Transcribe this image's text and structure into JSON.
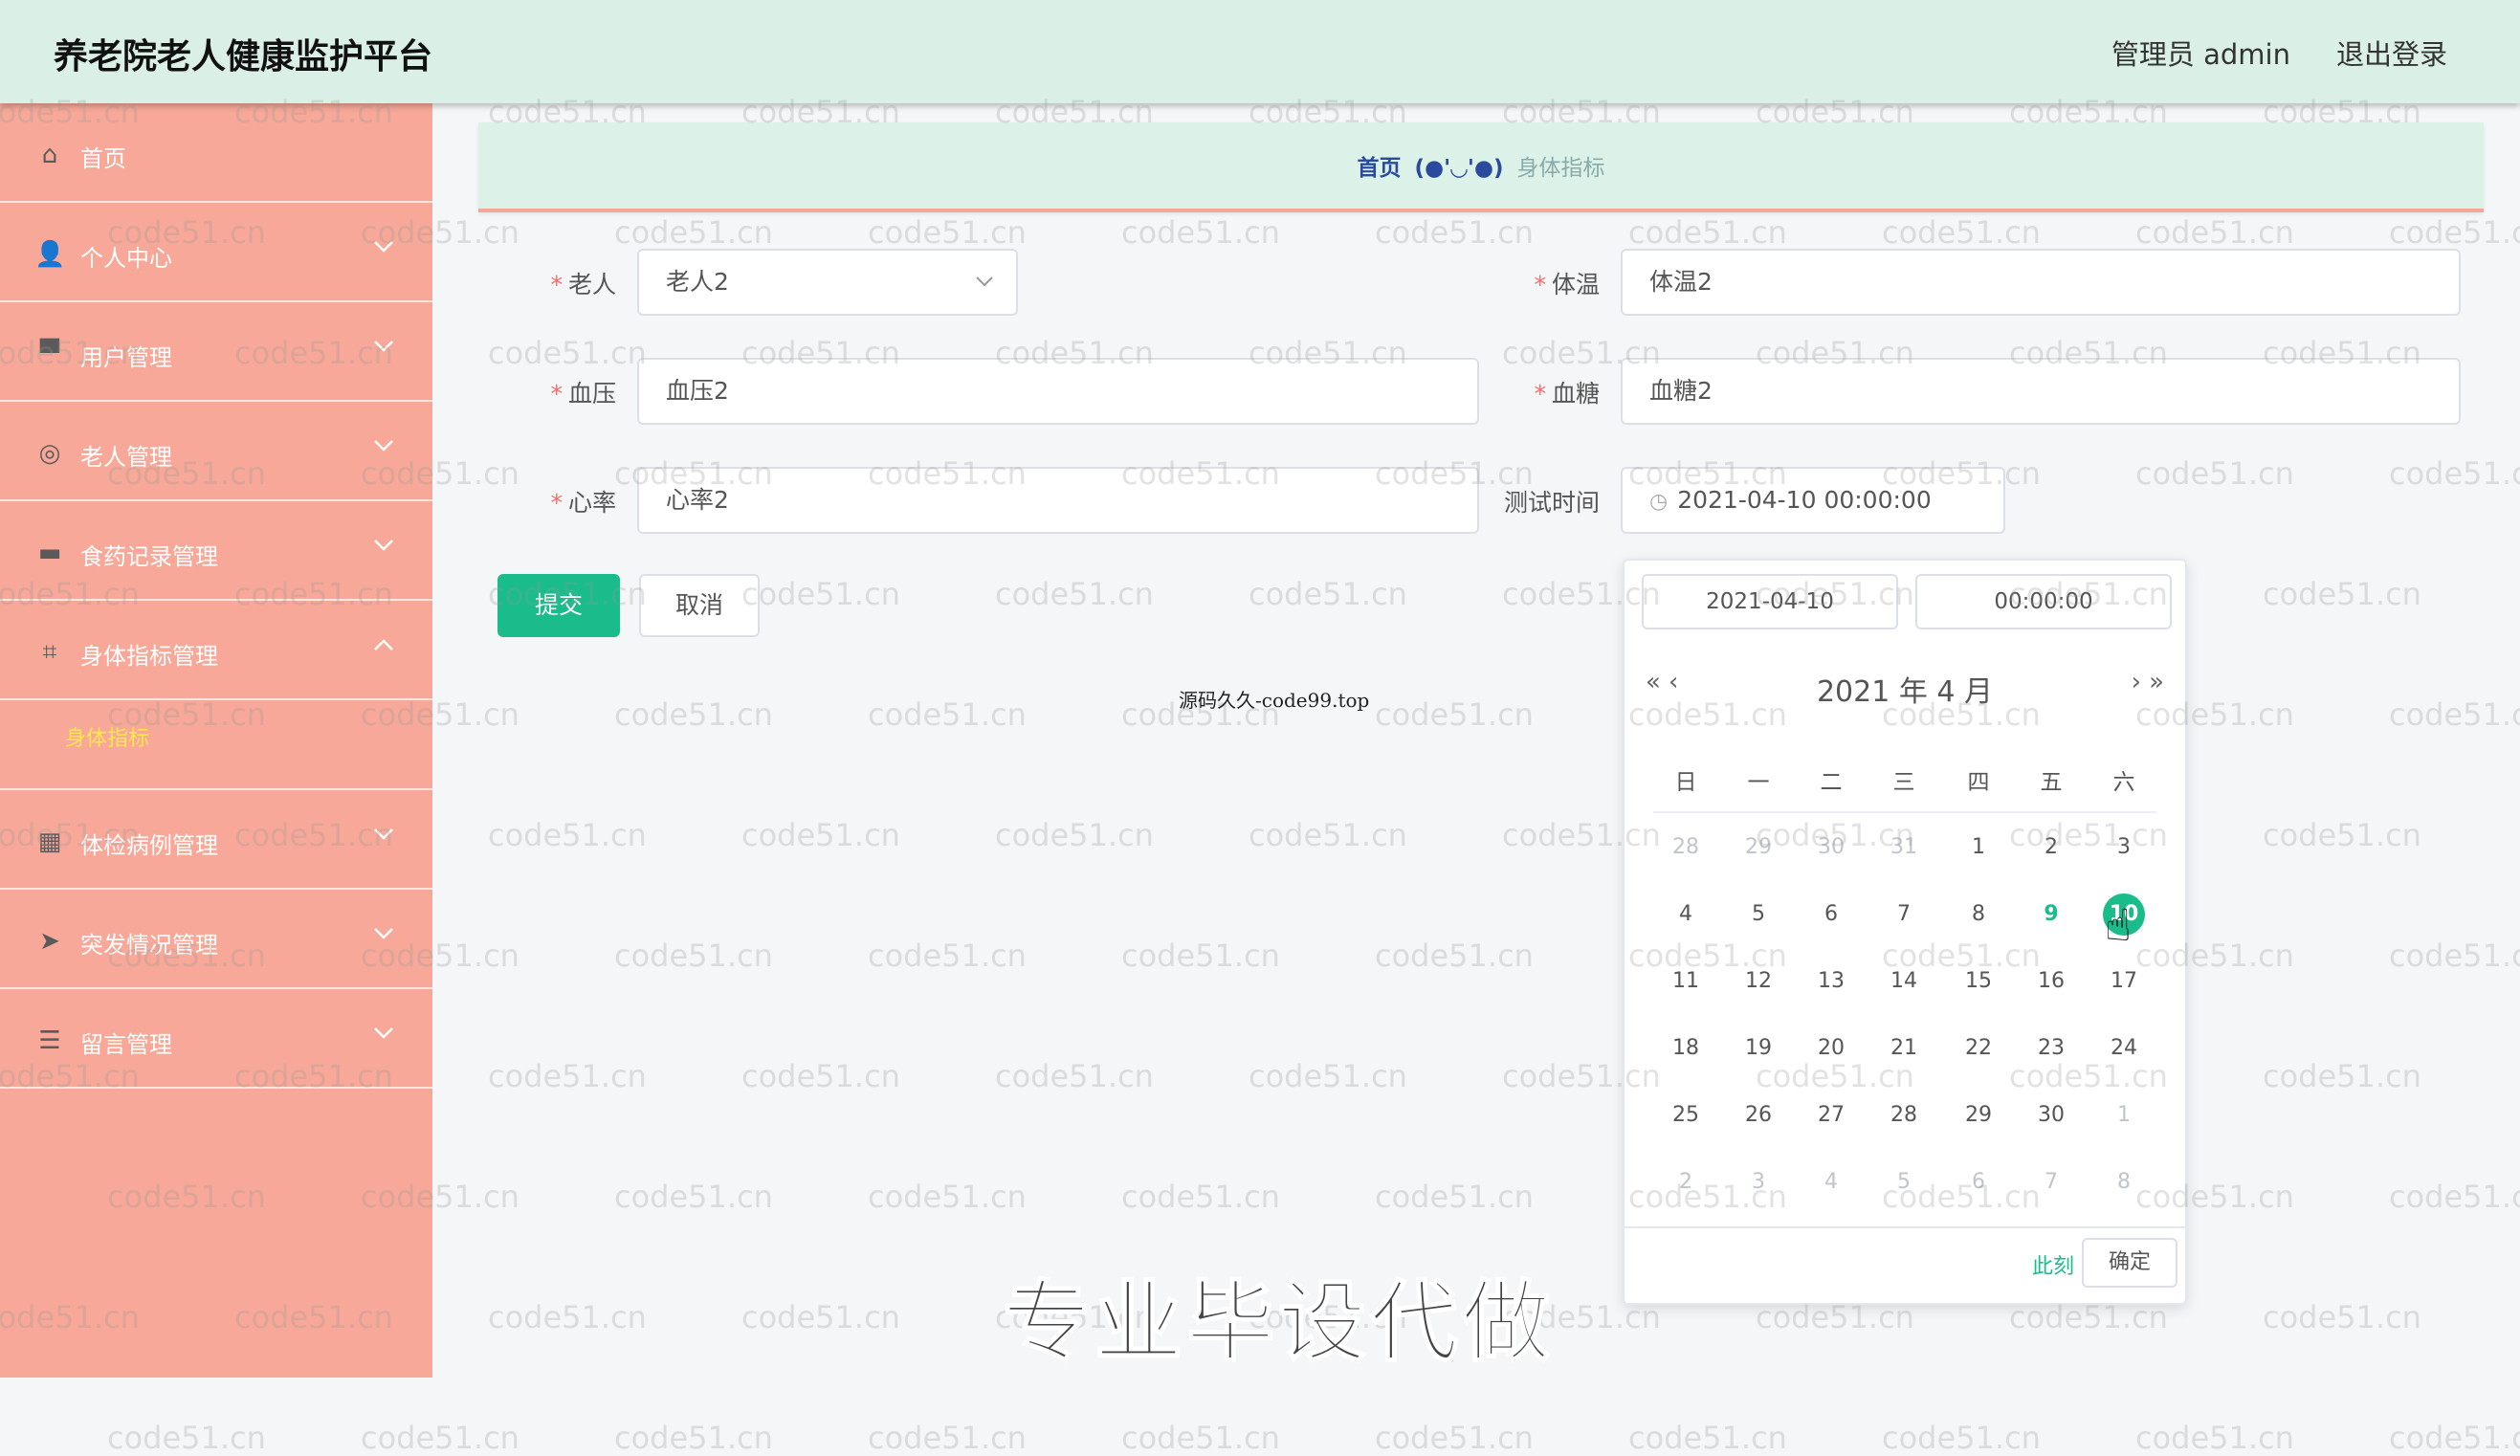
{
  "header": {
    "app_title": "养老院老人健康监护平台",
    "admin_label": "管理员 admin",
    "logout_label": "退出登录"
  },
  "sidebar": {
    "items": [
      {
        "label": "首页",
        "icon": "home-icon",
        "arrow": false
      },
      {
        "label": "个人中心",
        "icon": "user-icon",
        "arrow": true
      },
      {
        "label": "用户管理",
        "icon": "display-icon",
        "arrow": true
      },
      {
        "label": "老人管理",
        "icon": "compass-icon",
        "arrow": true
      },
      {
        "label": "食药记录管理",
        "icon": "monitor-icon",
        "arrow": true
      },
      {
        "label": "身体指标管理",
        "icon": "crop-icon",
        "arrow": true,
        "expanded": true,
        "subitems": [
          "身体指标"
        ]
      },
      {
        "label": "体检病例管理",
        "icon": "grid-icon",
        "arrow": true
      },
      {
        "label": "突发情况管理",
        "icon": "navigation-icon",
        "arrow": true
      },
      {
        "label": "留言管理",
        "icon": "list-icon",
        "arrow": true
      }
    ]
  },
  "breadcrumb": {
    "home": "首页",
    "separator": "(●'◡'●)",
    "current": "身体指标"
  },
  "form": {
    "elder": {
      "label": "老人",
      "value": "老人2",
      "required": true
    },
    "temperature": {
      "label": "体温",
      "value": "体温2",
      "required": true
    },
    "blood_pressure": {
      "label": "血压",
      "value": "血压2",
      "required": true
    },
    "blood_sugar": {
      "label": "血糖",
      "value": "血糖2",
      "required": true
    },
    "heart_rate": {
      "label": "心率",
      "value": "心率2",
      "required": true
    },
    "test_time": {
      "label": "测试时间",
      "value": "2021-04-10 00:00:00"
    },
    "submit_label": "提交",
    "cancel_label": "取消"
  },
  "datepicker": {
    "date_input": "2021-04-10",
    "time_input": "00:00:00",
    "prev_year": "«",
    "prev_month": "‹",
    "next_month": "›",
    "next_year": "»",
    "title": "2021 年  4 月",
    "weekdays": [
      "日",
      "一",
      "二",
      "三",
      "四",
      "五",
      "六"
    ],
    "weeks": [
      [
        {
          "d": "28",
          "o": true
        },
        {
          "d": "29",
          "o": true
        },
        {
          "d": "30",
          "o": true
        },
        {
          "d": "31",
          "o": true
        },
        {
          "d": "1"
        },
        {
          "d": "2"
        },
        {
          "d": "3"
        }
      ],
      [
        {
          "d": "4"
        },
        {
          "d": "5"
        },
        {
          "d": "6"
        },
        {
          "d": "7"
        },
        {
          "d": "8"
        },
        {
          "d": "9",
          "today": true
        },
        {
          "d": "10",
          "sel": true
        }
      ],
      [
        {
          "d": "11"
        },
        {
          "d": "12"
        },
        {
          "d": "13"
        },
        {
          "d": "14"
        },
        {
          "d": "15"
        },
        {
          "d": "16"
        },
        {
          "d": "17"
        }
      ],
      [
        {
          "d": "18"
        },
        {
          "d": "19"
        },
        {
          "d": "20"
        },
        {
          "d": "21"
        },
        {
          "d": "22"
        },
        {
          "d": "23"
        },
        {
          "d": "24"
        }
      ],
      [
        {
          "d": "25"
        },
        {
          "d": "26"
        },
        {
          "d": "27"
        },
        {
          "d": "28"
        },
        {
          "d": "29"
        },
        {
          "d": "30"
        },
        {
          "d": "1",
          "o": true
        }
      ],
      [
        {
          "d": "2",
          "o": true
        },
        {
          "d": "3",
          "o": true
        },
        {
          "d": "4",
          "o": true
        },
        {
          "d": "5",
          "o": true
        },
        {
          "d": "6",
          "o": true
        },
        {
          "d": "7",
          "o": true
        },
        {
          "d": "8",
          "o": true
        }
      ]
    ],
    "now_label": "此刻",
    "ok_label": "确定"
  },
  "overlay": {
    "small_text": "源码久久-code99.top",
    "big_text": "专业毕设代做",
    "watermark": "code51.cn"
  },
  "colors": {
    "topbar": "#daf0e6",
    "sidebar": "#f7a898",
    "primary": "#1abc8c",
    "active_submenu": "#ffe84a"
  }
}
